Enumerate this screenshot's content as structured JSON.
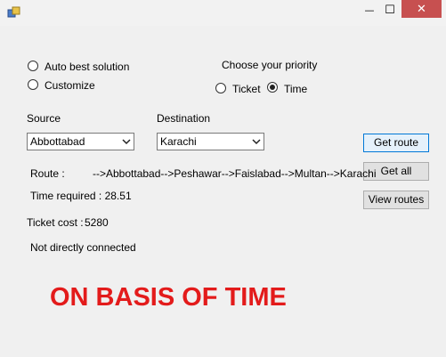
{
  "titlebar": {
    "min_glyph": "—",
    "max_glyph": "☐",
    "close_glyph": "✕"
  },
  "options": {
    "auto_best_label": "Auto best solution",
    "customize_label": "Customize",
    "auto_best_selected": false,
    "customize_selected": false
  },
  "priority": {
    "heading": "Choose your priority",
    "ticket_label": "Ticket",
    "time_label": "Time",
    "selected": "Time"
  },
  "source": {
    "label": "Source",
    "value": "Abbottabad"
  },
  "destination": {
    "label": "Destination",
    "value": "Karachi"
  },
  "buttons": {
    "get_route": "Get route",
    "get_all": "Get all",
    "view_routes": "View routes"
  },
  "result": {
    "route_label": "Route :",
    "route_value": "-->Abbottabad-->Peshawar-->Faislabad-->Multan-->Karachi",
    "time_required": "Time required : 28.51",
    "ticket_cost_label": "Ticket cost :",
    "ticket_cost_value": "5280",
    "connection_status": "Not directly connected"
  },
  "overlay": {
    "caption": "ON BASIS OF TIME",
    "color": "#e31b1b"
  }
}
